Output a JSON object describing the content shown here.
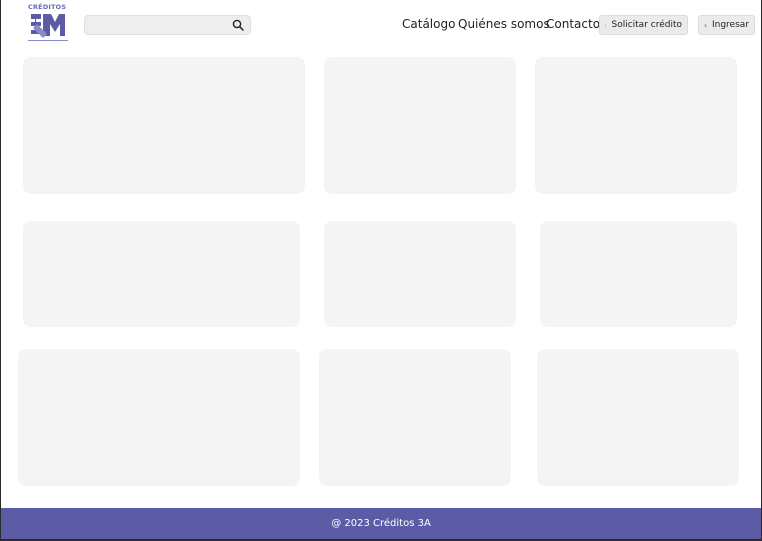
{
  "brand": {
    "logo_text": "CRÉDITOS",
    "logo_icon": "3a-monogram-icon",
    "primary_color": "#5c5ca6"
  },
  "search": {
    "value": "",
    "placeholder": "",
    "icon": "search-icon"
  },
  "nav": {
    "items": [
      {
        "label": "Catálogo"
      },
      {
        "label": "Quiénes somos"
      },
      {
        "label": "Contacto"
      }
    ]
  },
  "actions": {
    "credit_label": "Solicitar crédito",
    "credit_icon": "id-card-icon",
    "login_label": "Ingresar",
    "login_icon": "user-icon"
  },
  "content": {
    "card_color": "#f4f4f4"
  },
  "footer": {
    "text": "@ 2023 Créditos 3A"
  }
}
